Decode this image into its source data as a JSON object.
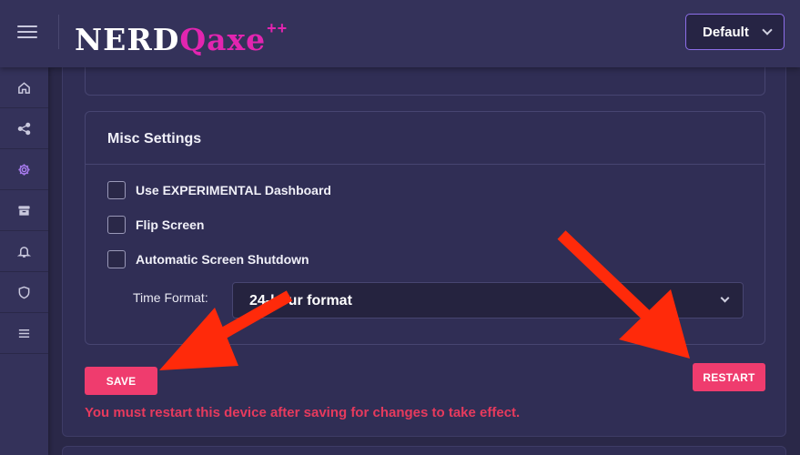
{
  "header": {
    "logo_main": "NERD",
    "logo_accent": "Qaxe",
    "logo_sup": "++",
    "theme_value": "Default"
  },
  "sidebar": {
    "items": [
      {
        "icon": "home-icon",
        "active": false
      },
      {
        "icon": "share-icon",
        "active": false
      },
      {
        "icon": "gear-icon",
        "active": true
      },
      {
        "icon": "archive-icon",
        "active": false
      },
      {
        "icon": "bell-icon",
        "active": false
      },
      {
        "icon": "shield-icon",
        "active": false
      },
      {
        "icon": "menu-icon",
        "active": false
      }
    ]
  },
  "misc": {
    "title": "Misc Settings",
    "options": [
      {
        "label": "Use EXPERIMENTAL Dashboard",
        "checked": false
      },
      {
        "label": "Flip Screen",
        "checked": false
      },
      {
        "label": "Automatic Screen Shutdown",
        "checked": false
      }
    ],
    "time_format_label": "Time Format:",
    "time_format_value": "24-hour format"
  },
  "actions": {
    "save_label": "SAVE",
    "restart_label": "RESTART",
    "warning": "You must restart this device after saving for changes to take effect."
  },
  "colors": {
    "accent": "#ef3c6e",
    "brand": "#e225b0",
    "active_icon": "#a97cf0",
    "arrow": "#ff2a0a",
    "warning": "#e63a5d"
  }
}
